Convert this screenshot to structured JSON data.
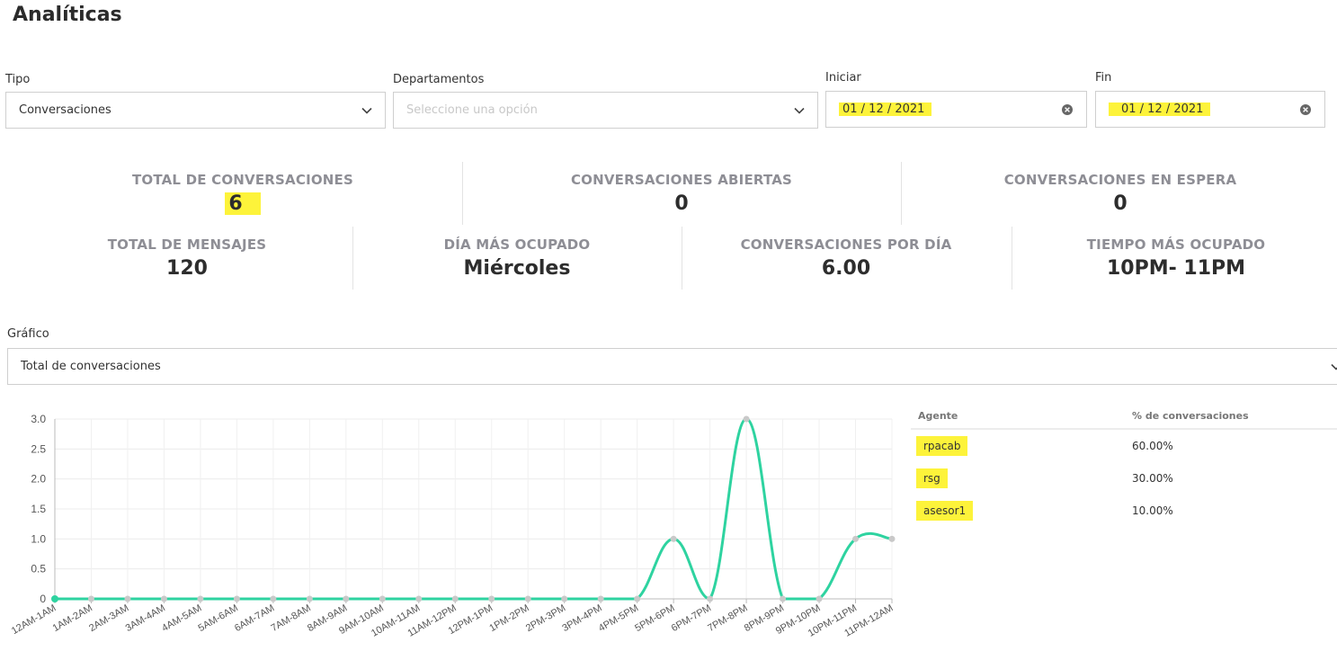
{
  "page_title": "Analíticas",
  "filters": {
    "tipo": {
      "label": "Tipo",
      "value": "Conversaciones"
    },
    "departamentos": {
      "label": "Departamentos",
      "placeholder": "Seleccione una opción"
    },
    "iniciar": {
      "label": "Iniciar",
      "value": "01 / 12 / 2021"
    },
    "fin": {
      "label": "Fin",
      "value": "01 / 12 / 2021"
    }
  },
  "stats_row1": [
    {
      "label": "TOTAL DE CONVERSACIONES",
      "value": "6"
    },
    {
      "label": "CONVERSACIONES ABIERTAS",
      "value": "0"
    },
    {
      "label": "CONVERSACIONES EN ESPERA",
      "value": "0"
    }
  ],
  "stats_row2": [
    {
      "label": "TOTAL DE MENSAJES",
      "value": "120"
    },
    {
      "label": "DÍA MÁS OCUPADO",
      "value": "Miércoles"
    },
    {
      "label": "CONVERSACIONES POR DÍA",
      "value": "6.00"
    },
    {
      "label": "TIEMPO MÁS OCUPADO",
      "value": "10PM- 11PM"
    }
  ],
  "grafico": {
    "label": "Gráfico",
    "value": "Total de conversaciones"
  },
  "chart_data": {
    "type": "line",
    "categories": [
      "12AM-1AM",
      "1AM-2AM",
      "2AM-3AM",
      "3AM-4AM",
      "4AM-5AM",
      "5AM-6AM",
      "6AM-7AM",
      "7AM-8AM",
      "8AM-9AM",
      "9AM-10AM",
      "10AM-11AM",
      "11AM-12PM",
      "12PM-1PM",
      "1PM-2PM",
      "2PM-3PM",
      "3PM-4PM",
      "4PM-5PM",
      "5PM-6PM",
      "6PM-7PM",
      "7PM-8PM",
      "8PM-9PM",
      "9PM-10PM",
      "10PM-11PM",
      "11PM-12AM"
    ],
    "values": [
      0,
      0,
      0,
      0,
      0,
      0,
      0,
      0,
      0,
      0,
      0,
      0,
      0,
      0,
      0,
      0,
      0,
      1,
      0,
      3,
      0,
      0,
      1,
      1
    ],
    "yticks": [
      "0",
      "0.5",
      "1.0",
      "1.5",
      "2.0",
      "2.5",
      "3.0"
    ],
    "ylim": [
      0,
      3
    ],
    "grid": true,
    "line_color": "#2ed3a0",
    "point_color": "#c9c9c9"
  },
  "agents_table": {
    "headers": [
      "Agente",
      "% de conversaciones"
    ],
    "rows": [
      {
        "agent": "rpacab",
        "percent": "60.00%"
      },
      {
        "agent": "rsg",
        "percent": "30.00%"
      },
      {
        "agent": "asesor1",
        "percent": "10.00%"
      }
    ]
  },
  "colors": {
    "highlight": "#fdf33a",
    "accent": "#2ed3a0"
  },
  "icons": {
    "dropdown": "chevron-down-icon",
    "clear": "clear-circle-icon"
  }
}
